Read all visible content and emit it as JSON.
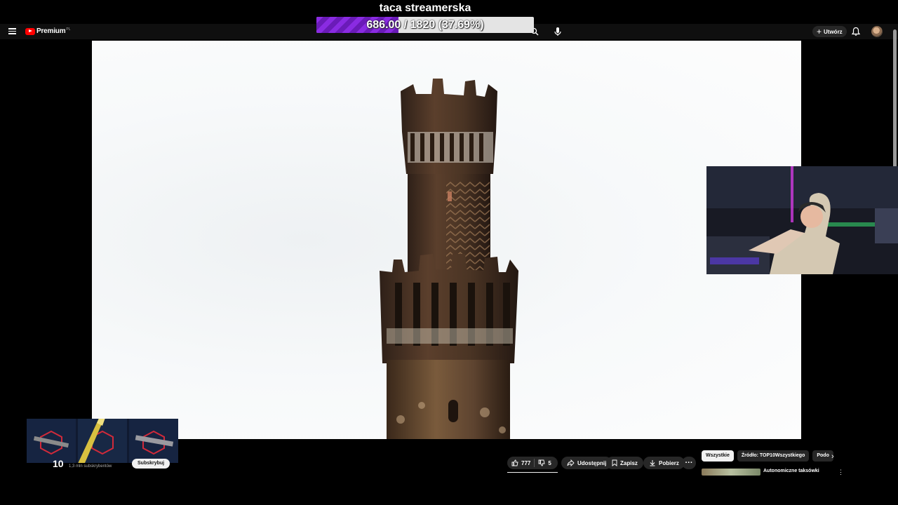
{
  "overlay": {
    "title": "taca streamerska",
    "progress_text": "686.00 / 1820 (37.69%)",
    "progress_fraction": 0.3769,
    "fill_color": "#8a2be2"
  },
  "header": {
    "logo_text": "Premium",
    "logo_region": "PL",
    "create_label": "Utwórz",
    "icons": [
      "menu-icon",
      "youtube-logo-icon",
      "search-icon",
      "mic-icon",
      "plus-icon",
      "bell-icon"
    ]
  },
  "channel": {
    "number": "10",
    "subscribers": "1,3 mln subskrybentów",
    "subscribe_label": "Subskrybuj"
  },
  "actions": {
    "likes": "777",
    "dislikes": "5",
    "share": "Udostępnij",
    "save": "Zapisz",
    "download": "Pobierz",
    "more": "···"
  },
  "chips": [
    "Wszystkie",
    "Źródło: TOP10Wszystkiego",
    "Podo"
  ],
  "recommendation": {
    "title": "Autonomiczne taksówki"
  },
  "colors": {
    "brand": "#ff0000",
    "background": "#0f0f0f",
    "chip_active": "#f1f1f1"
  }
}
